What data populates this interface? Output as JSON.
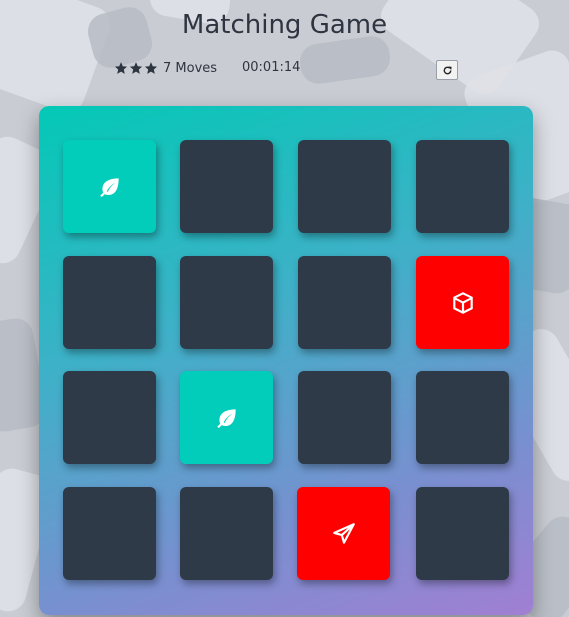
{
  "header": {
    "title": "Matching Game"
  },
  "score_panel": {
    "stars": [
      {
        "icon": "star-icon"
      },
      {
        "icon": "star-icon"
      },
      {
        "icon": "star-icon"
      }
    ],
    "moves_count": "7",
    "moves_label": "Moves",
    "timer": "00:01:14",
    "restart_icon": "restart-icon"
  },
  "deck": {
    "cards": [
      {
        "state": "match",
        "icon": "leaf-icon"
      },
      {
        "state": "closed"
      },
      {
        "state": "closed"
      },
      {
        "state": "closed"
      },
      {
        "state": "closed"
      },
      {
        "state": "closed"
      },
      {
        "state": "closed"
      },
      {
        "state": "wrong",
        "icon": "cube-icon"
      },
      {
        "state": "closed"
      },
      {
        "state": "match",
        "icon": "leaf-icon"
      },
      {
        "state": "closed"
      },
      {
        "state": "closed"
      },
      {
        "state": "closed"
      },
      {
        "state": "closed"
      },
      {
        "state": "wrong",
        "icon": "paper-plane-icon"
      },
      {
        "state": "closed"
      }
    ]
  },
  "colors": {
    "match": "#02ccba",
    "wrong": "#ff0000",
    "closed": "#2e3a48"
  }
}
